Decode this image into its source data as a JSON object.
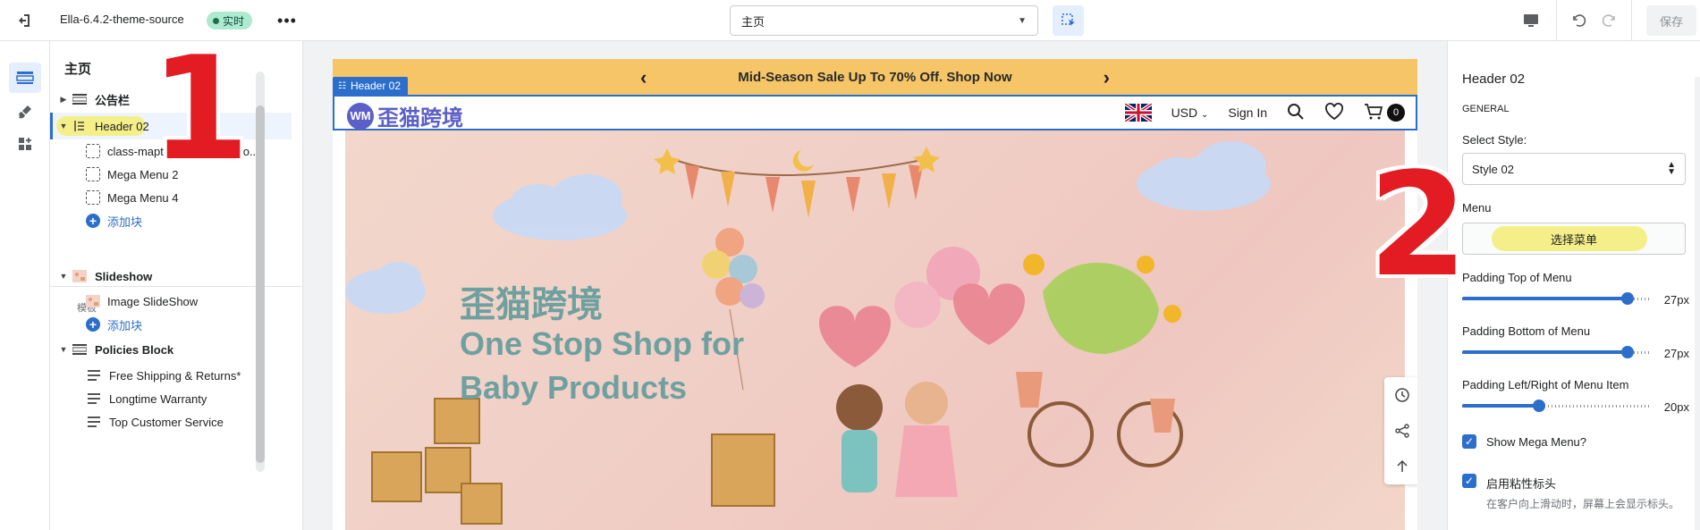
{
  "topbar": {
    "theme_name": "Ella-6.4.2-theme-source",
    "live_badge": "实时",
    "page_select_value": "主页",
    "save_label": "保存"
  },
  "tree": {
    "title": "主页",
    "group_label": "模板",
    "rows": [
      {
        "label": "公告栏"
      },
      {
        "label": "Header 02"
      },
      {
        "label": "class-mapten-tacitos-del-so..."
      },
      {
        "label": "Mega Menu 2"
      },
      {
        "label": "Mega Menu 4"
      },
      {
        "label": "添加块"
      },
      {
        "label": "Slideshow"
      },
      {
        "label": "Image SlideShow"
      },
      {
        "label": "添加块"
      },
      {
        "label": "Policies Block"
      },
      {
        "label": "Free Shipping & Returns*"
      },
      {
        "label": "Longtime Warranty"
      },
      {
        "label": "Top Customer Service"
      }
    ]
  },
  "preview": {
    "announcement": "Mid-Season Sale Up To 70% Off. Shop Now",
    "selected_tag": "Header 02",
    "logo_mark": "WM",
    "logo_text": "歪猫跨境",
    "currency": "USD",
    "sign_in": "Sign In",
    "cart_count": "0",
    "hero_cn": "歪猫跨境",
    "hero_line1": "One Stop Shop for",
    "hero_line2": "Baby Products"
  },
  "settings": {
    "title": "Header 02",
    "heading": "GENERAL",
    "select_style_label": "Select Style:",
    "select_style_value": "Style 02",
    "menu_label": "Menu",
    "menu_button": "选择菜单",
    "sliders": [
      {
        "label": "Padding Top of Menu",
        "value": 27,
        "max": 30,
        "display": "27px"
      },
      {
        "label": "Padding Bottom of Menu",
        "value": 27,
        "max": 30,
        "display": "27px"
      },
      {
        "label": "Padding Left/Right of Menu Item",
        "value": 20,
        "max": 50,
        "display": "20px"
      }
    ],
    "checkbox_mega": "Show Mega Menu?",
    "checkbox_sticky": "启用粘性标头",
    "sticky_help": "在客户向上滑动时，屏幕上会显示标头。"
  },
  "annotations": {
    "one": "1",
    "two": "2"
  },
  "colors": {
    "accent": "#2c6ecb",
    "announcement_bg": "#f5c568",
    "highlight": "#f5ef8a",
    "hero_text": "#6fa0a0",
    "logo": "#5b5fc7"
  }
}
